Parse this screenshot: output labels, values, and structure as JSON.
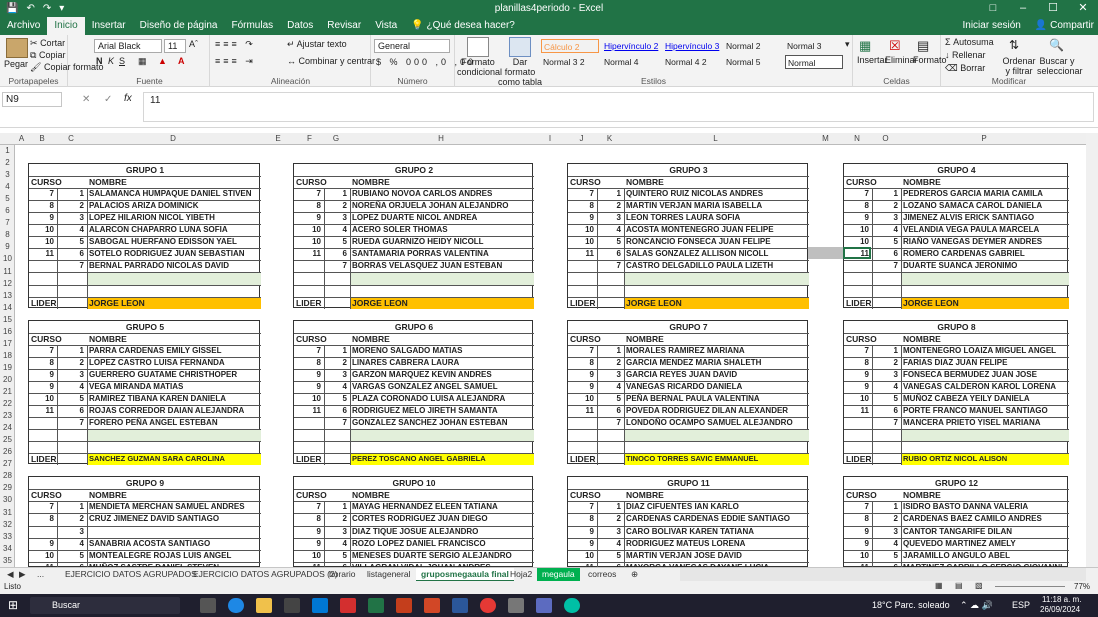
{
  "window": {
    "title": "planillas4periodo - Excel",
    "account": "Iniciar sesión",
    "share": "Compartir"
  },
  "tabs": [
    "Archivo",
    "Inicio",
    "Insertar",
    "Diseño de página",
    "Fórmulas",
    "Datos",
    "Revisar",
    "Vista",
    "¿Qué desea hacer?"
  ],
  "ribbon": {
    "clipboard": {
      "paste": "Pegar",
      "cut": "Cortar",
      "copy": "Copiar",
      "format_painter": "Copiar formato",
      "label": "Portapapeles"
    },
    "font": {
      "name": "Arial Black",
      "size": "11",
      "label": "Fuente"
    },
    "alignment": {
      "wrap": "Ajustar texto",
      "merge": "Combinar y centrar",
      "label": "Alineación"
    },
    "number": {
      "format": "General",
      "label": "Número"
    },
    "styles": {
      "conditional": "Formato condicional",
      "table": "Dar formato como tabla",
      "cells": [
        "Cálculo 2",
        "Hipervínculo 2",
        "Hipervínculo 3",
        "Normal 2",
        "Normal 3",
        "Normal 3 2",
        "Normal 4",
        "Normal 4 2",
        "Normal 5",
        "Normal"
      ],
      "label": "Estilos"
    },
    "cells": {
      "insert": "Insertar",
      "delete": "Eliminar",
      "format": "Formato",
      "label": "Celdas"
    },
    "editing": {
      "autosum": "Autosuma",
      "fill": "Rellenar",
      "clear": "Borrar",
      "sort": "Ordenar y filtrar",
      "find": "Buscar y seleccionar",
      "label": "Modificar"
    }
  },
  "formula_bar": {
    "name_box": "N9",
    "fx": "fx",
    "value": "11"
  },
  "columns": [
    "A",
    "B",
    "C",
    "D",
    "E",
    "F",
    "G",
    "H",
    "I",
    "J",
    "K",
    "L",
    "M",
    "N",
    "O",
    "P"
  ],
  "rows": [
    "1",
    "2",
    "3",
    "4",
    "5",
    "6",
    "7",
    "8",
    "9",
    "10",
    "11",
    "12",
    "13",
    "14",
    "15",
    "16",
    "17",
    "18",
    "19",
    "20",
    "21",
    "22",
    "23",
    "24",
    "25",
    "26",
    "27",
    "28",
    "29",
    "30",
    "31",
    "32",
    "33",
    "34",
    "35"
  ],
  "labels": {
    "curso": "CURSO",
    "nombre": "NOMBRE",
    "lider": "LIDER"
  },
  "groups": [
    {
      "title": "GRUPO 1",
      "rows": [
        [
          "7",
          "1",
          "SALAMANCA HUMPAQUE DANIEL STIVEN"
        ],
        [
          "8",
          "2",
          "PALACIOS ARIZA DOMINICK"
        ],
        [
          "9",
          "3",
          "LOPEZ HILARION NICOL YIBETH"
        ],
        [
          "10",
          "4",
          "ALARCON CHAPARRO LUNA SOFIA"
        ],
        [
          "10",
          "5",
          "SABOGAL HUERFANO EDISSON YAEL"
        ],
        [
          "11",
          "6",
          "SOTELO RODRIGUEZ JUAN SEBASTIAN"
        ],
        [
          "",
          "7",
          "BERNAL PARRADO NICOLAS DAVID"
        ]
      ],
      "lider": "JORGE LEON",
      "lider_color": "#ffc000"
    },
    {
      "title": "GRUPO 2",
      "rows": [
        [
          "7",
          "1",
          "RUBIANO NOVOA CARLOS ANDRES"
        ],
        [
          "8",
          "2",
          "NOREÑA ORJUELA JOHAN ALEJANDRO"
        ],
        [
          "9",
          "3",
          "LOPEZ DUARTE NICOL ANDREA"
        ],
        [
          "10",
          "4",
          "ACERO SOLER THOMAS"
        ],
        [
          "10",
          "5",
          "RUEDA GUARNIZO HEIDY NICOLL"
        ],
        [
          "11",
          "6",
          "SANTAMARIA PORRAS VALENTINA"
        ],
        [
          "",
          "7",
          "BORRAS VELASQUEZ JUAN ESTEBAN"
        ]
      ],
      "lider": "JORGE LEON",
      "lider_color": "#ffc000"
    },
    {
      "title": "GRUPO 3",
      "rows": [
        [
          "7",
          "1",
          "QUINTERO RUIZ NICOLAS ANDRES"
        ],
        [
          "8",
          "2",
          "MARTIN VERJAN MARIA ISABELLA"
        ],
        [
          "9",
          "3",
          "LEON TORRES LAURA SOFIA"
        ],
        [
          "10",
          "4",
          "ACOSTA MONTENEGRO JUAN FELIPE"
        ],
        [
          "10",
          "5",
          "RONCANCIO FONSECA JUAN FELIPE"
        ],
        [
          "11",
          "6",
          "SALAS GONZALEZ ALLISON NICOLL"
        ],
        [
          "",
          "7",
          "CASTRO DELGADILLO PAULA LIZETH"
        ]
      ],
      "lider": "JORGE LEON",
      "lider_color": "#ffc000"
    },
    {
      "title": "GRUPO 4",
      "rows": [
        [
          "7",
          "1",
          "PEDREROS GARCIA MARIA CAMILA"
        ],
        [
          "8",
          "2",
          "LOZANO SAMACA CAROL DANIELA"
        ],
        [
          "9",
          "3",
          "JIMENEZ ALVIS ERICK SANTIAGO"
        ],
        [
          "10",
          "4",
          "VELANDIA VEGA PAULA MARCELA"
        ],
        [
          "10",
          "5",
          "RIAÑO VANEGAS DEYMER ANDRES"
        ],
        [
          "11",
          "6",
          "ROMERO CARDENAS GABRIEL"
        ],
        [
          "",
          "7",
          "DUARTE SUANCA JERONIMO"
        ]
      ],
      "lider": "JORGE LEON",
      "lider_color": "#ffc000"
    },
    {
      "title": "GRUPO 5",
      "rows": [
        [
          "7",
          "1",
          "PARRA CARDENAS EMILY GISSEL"
        ],
        [
          "8",
          "2",
          "LOPEZ CASTRO LUISA FERNANDA"
        ],
        [
          "9",
          "3",
          "GUERRERO GUATAME CHRISTHOPER"
        ],
        [
          "9",
          "4",
          "VEGA MIRANDA MATIAS"
        ],
        [
          "10",
          "5",
          "RAMIREZ TIBANA KAREN DANIELA"
        ],
        [
          "11",
          "6",
          "ROJAS CORREDOR DAIAN ALEJANDRA"
        ],
        [
          "",
          "7",
          "FORERO PEÑA ANGEL ESTEBAN"
        ]
      ],
      "lider": "SANCHEZ GUZMAN SARA CAROLINA",
      "lider_color": "#ffff00"
    },
    {
      "title": "GRUPO  6",
      "rows": [
        [
          "7",
          "1",
          "MORENO SALGADO MATIAS"
        ],
        [
          "8",
          "2",
          "LINARES CABRERA LAURA"
        ],
        [
          "9",
          "3",
          "GARZON MARQUEZ KEVIN ANDRES"
        ],
        [
          "9",
          "4",
          "VARGAS GONZALEZ ANGEL SAMUEL"
        ],
        [
          "10",
          "5",
          "PLAZA CORONADO LUISA ALEJANDRA"
        ],
        [
          "11",
          "6",
          "RODRIGUEZ MELO JIRETH SAMANTA"
        ],
        [
          "",
          "7",
          "GONZALEZ SANCHEZ JOHAN ESTEBAN"
        ]
      ],
      "lider": "PEREZ TOSCANO ANGEL GABRIELA",
      "lider_color": "#ffff00"
    },
    {
      "title": "GRUPO 7",
      "rows": [
        [
          "7",
          "1",
          "MORALES RAMIREZ MARIANA"
        ],
        [
          "8",
          "2",
          "GARCIA MENDEZ MARIA SHALETH"
        ],
        [
          "9",
          "3",
          "GARCIA REYES JUAN DAVID"
        ],
        [
          "9",
          "4",
          "VANEGAS RICARDO DANIELA"
        ],
        [
          "10",
          "5",
          "PEÑA BERNAL PAULA VALENTINA"
        ],
        [
          "11",
          "6",
          "POVEDA RODRIGUEZ DILAN ALEXANDER"
        ],
        [
          "",
          "7",
          "LONDOÑO OCAMPO SAMUEL ALEJANDRO"
        ]
      ],
      "lider": "TINOCO TORRES SAVIC EMMANUEL",
      "lider_color": "#ffff00"
    },
    {
      "title": "GRUPO 8",
      "rows": [
        [
          "7",
          "1",
          "MONTENEGRO LOAIZA MIGUEL ANGEL"
        ],
        [
          "8",
          "2",
          "FARIAS DIAZ JUAN FELIPE"
        ],
        [
          "9",
          "3",
          "FONSECA BERMUDEZ JUAN JOSE"
        ],
        [
          "9",
          "4",
          "VANEGAS CALDERON KAROL LORENA"
        ],
        [
          "10",
          "5",
          "MUÑOZ CABEZA YEILY DANIELA"
        ],
        [
          "11",
          "6",
          "PORTE FRANCO MANUEL SANTIAGO"
        ],
        [
          "",
          "7",
          "MANCERA PRIETO YISEL MARIANA"
        ]
      ],
      "lider": "RUBIO ORTIZ NICOL ALISON",
      "lider_color": "#ffff00"
    },
    {
      "title": "GRUPO 9",
      "rows": [
        [
          "7",
          "1",
          "MENDIETA MERCHAN SAMUEL ANDRES"
        ],
        [
          "8",
          "2",
          "CRUZ  JIMENEZ DAVID SANTIAGO"
        ],
        [
          "",
          "3",
          ""
        ],
        [
          "9",
          "4",
          "SANABRIA ACOSTA SANTIAGO"
        ],
        [
          "10",
          "5",
          "MONTEALEGRE ROJAS LUIS ANGEL"
        ],
        [
          "11",
          "6",
          "MUÑOZ SASTRE DANIEL STEVEN"
        ]
      ],
      "lider": "",
      "lider_color": ""
    },
    {
      "title": "GRUPO 10",
      "rows": [
        [
          "7",
          "1",
          "MAYAG HERNANDEZ ELEEN TATIANA"
        ],
        [
          "8",
          "2",
          "CORTES RODRIGUEZ JUAN DIEGO"
        ],
        [
          "9",
          "3",
          "DIAZ TIQUE JOSUE ALEJANDRO"
        ],
        [
          "9",
          "4",
          "ROZO LOPEZ DANIEL FRANCISCO"
        ],
        [
          "10",
          "5",
          "MENESES DUARTE SERGIO ALEJANDRO"
        ],
        [
          "11",
          "6",
          "VILLAGRAN VIDAL JOHAN ANDRES"
        ]
      ],
      "lider": "",
      "lider_color": ""
    },
    {
      "title": "GRUPO 11",
      "rows": [
        [
          "7",
          "1",
          "DIAZ CIFUENTES IAN KARLO"
        ],
        [
          "8",
          "2",
          "CARDENAS CARDENAS EDDIE SANTIAGO"
        ],
        [
          "9",
          "3",
          "CARO BOLIVAR KAREN TATIANA"
        ],
        [
          "9",
          "4",
          "RODRIGUEZ MATEUS LORENA"
        ],
        [
          "10",
          "5",
          "MARTIN VERJAN JOSE DAVID"
        ],
        [
          "11",
          "6",
          "MAYORGA VANEGAS DAYANE LUCIA"
        ]
      ],
      "lider": "",
      "lider_color": ""
    },
    {
      "title": "GRUPO 12",
      "rows": [
        [
          "7",
          "1",
          "ISIDRO BASTO DANNA VALERIA"
        ],
        [
          "8",
          "2",
          "CARDENAS BAEZ CAMILO ANDRES"
        ],
        [
          "9",
          "3",
          "CANTOR TANGARIFE DILAN"
        ],
        [
          "9",
          "4",
          "QUEVEDO MARTINEZ AMELY"
        ],
        [
          "10",
          "5",
          "JARAMILLO ANGULO ABEL"
        ],
        [
          "11",
          "6",
          "MARTINEZ CARRILLO SERGIO GIOVANNI"
        ]
      ],
      "lider": "",
      "lider_color": ""
    }
  ],
  "sheet_tabs": [
    "...",
    "EJERCICIO DATOS AGRUPADOS",
    "EJERCICIO DATOS AGRUPADOS  (2)",
    "horario",
    "listageneral",
    "gruposmegaaula final",
    "Hoja2",
    "megaula",
    "correos"
  ],
  "active_sheet": "gruposmegaaula final",
  "status": {
    "ready": "Listo",
    "zoom": "77%"
  },
  "taskbar": {
    "search": "Buscar",
    "weather": "18°C  Parc. soleado",
    "lang": "ESP",
    "time": "11:18 a. m.",
    "date": "26/09/2024"
  }
}
